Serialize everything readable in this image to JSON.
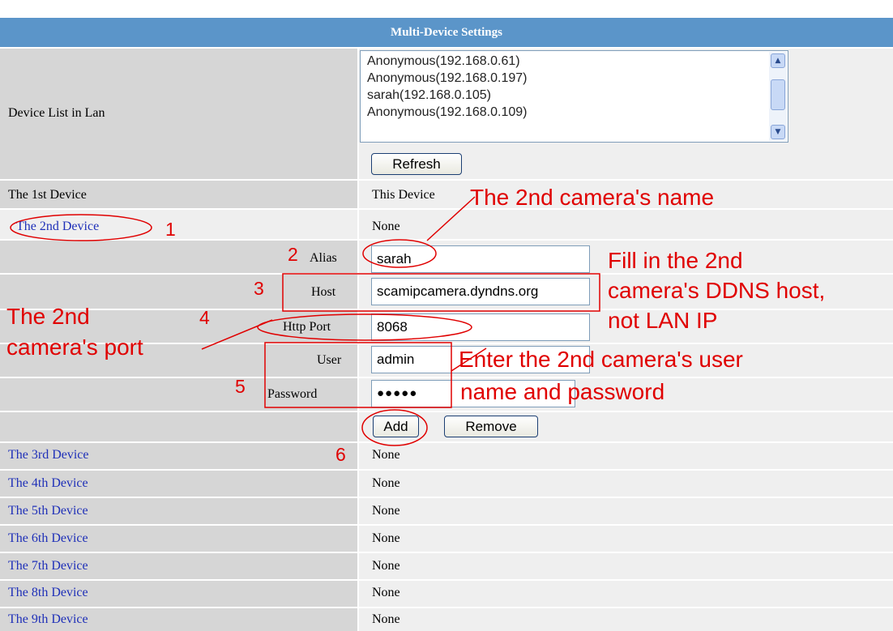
{
  "header": {
    "title": "Multi-Device Settings"
  },
  "device_list": {
    "label": "Device List in Lan",
    "items": [
      "Anonymous(192.168.0.61)",
      "Anonymous(192.168.0.197)",
      "sarah(192.168.0.105)",
      "Anonymous(192.168.0.109)"
    ],
    "refresh_label": "Refresh"
  },
  "devices": {
    "first": {
      "label": "The 1st Device",
      "value": "This Device"
    },
    "second": {
      "label": "The 2nd Device",
      "value": "None"
    },
    "rest": [
      {
        "label": "The 3rd Device",
        "value": "None"
      },
      {
        "label": "The 4th Device",
        "value": "None"
      },
      {
        "label": "The 5th Device",
        "value": "None"
      },
      {
        "label": "The 6th Device",
        "value": "None"
      },
      {
        "label": "The 7th Device",
        "value": "None"
      },
      {
        "label": "The 8th Device",
        "value": "None"
      },
      {
        "label": "The 9th Device",
        "value": "None"
      }
    ]
  },
  "form": {
    "alias": {
      "label": "Alias",
      "value": "sarah"
    },
    "host": {
      "label": "Host",
      "value": "scamipcamera.dyndns.org"
    },
    "port": {
      "label": "Http Port",
      "value": "8068"
    },
    "user": {
      "label": "User",
      "value": "admin"
    },
    "password": {
      "label": "Password",
      "value": "●●●●●"
    },
    "add_label": "Add",
    "remove_label": "Remove"
  },
  "annotations": {
    "camera_name": "The 2nd camera's name",
    "ddns_line1": "Fill in the 2nd",
    "ddns_line2": "camera's DDNS host,",
    "ddns_line3": "not LAN IP",
    "port_line1": "The 2nd",
    "port_line2": "camera's port",
    "credentials_line1": "Enter the 2nd camera's user",
    "credentials_line2": "name and password",
    "steps": [
      "1",
      "2",
      "3",
      "4",
      "5",
      "6"
    ]
  },
  "colors": {
    "header_bg": "#5b95c9",
    "label_cell_bg": "#d6d6d6",
    "value_cell_bg": "#efefef",
    "link_text": "#1f30b8",
    "annotation_red": "#e00000"
  }
}
